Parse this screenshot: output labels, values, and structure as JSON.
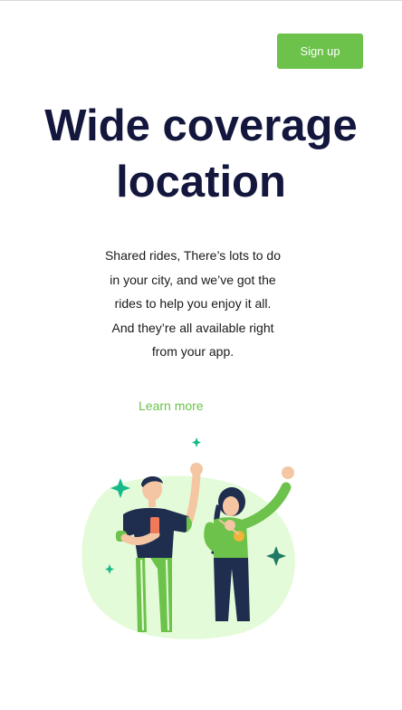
{
  "header": {
    "signup_label": "Sign up"
  },
  "hero": {
    "title_line1": "Wide coverage",
    "title_line2": "location",
    "description_lines": [
      "Shared rides, There’s lots to do",
      "in your city, and we’ve got the",
      "rides to help you enjoy it all.",
      "And they’re all available right",
      "from your app."
    ],
    "learn_more_label": "Learn more"
  },
  "illustration": {
    "icon_name": "two-people-waving-illustration",
    "colors": {
      "blob": "#e4fbd9",
      "green": "#6cc24a",
      "navy": "#1f2d4f",
      "sparkle": "#16b98a"
    }
  },
  "colors": {
    "accent": "#6cc24a",
    "heading": "#14173d"
  }
}
